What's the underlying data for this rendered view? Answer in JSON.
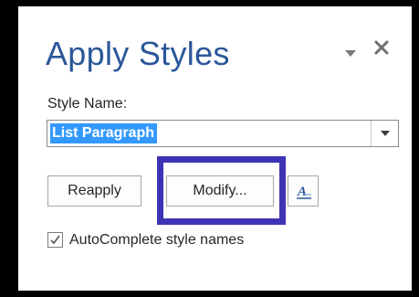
{
  "pane": {
    "title": "Apply Styles",
    "menu_icon": "dropdown-triangle-icon",
    "close_icon": "close-icon"
  },
  "style_name": {
    "label": "Style Name:",
    "value": "List Paragraph",
    "dropdown_icon": "chevron-down-icon"
  },
  "buttons": {
    "reapply": "Reapply",
    "modify": "Modify...",
    "styles_icon": "styles-icon",
    "styles_icon_text": "A"
  },
  "autocomplete": {
    "label": "AutoComplete style names",
    "checked": true
  },
  "colors": {
    "title": "#2b579a",
    "selection": "#3399ff",
    "highlight_box": "#3f33b5",
    "frame": "#000000"
  }
}
